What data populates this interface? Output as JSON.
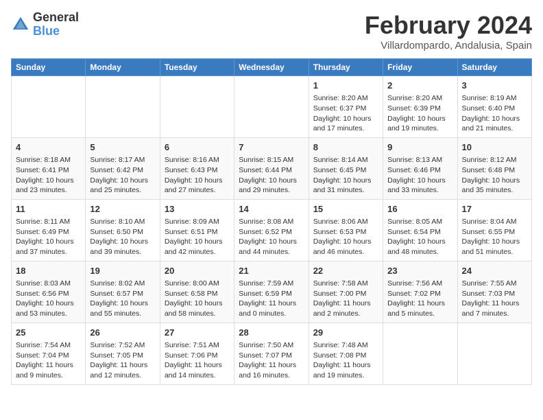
{
  "logo": {
    "line1": "General",
    "line2": "Blue"
  },
  "title": "February 2024",
  "subtitle": "Villardompardo, Andalusia, Spain",
  "headers": [
    "Sunday",
    "Monday",
    "Tuesday",
    "Wednesday",
    "Thursday",
    "Friday",
    "Saturday"
  ],
  "weeks": [
    [
      {
        "day": "",
        "info": ""
      },
      {
        "day": "",
        "info": ""
      },
      {
        "day": "",
        "info": ""
      },
      {
        "day": "",
        "info": ""
      },
      {
        "day": "1",
        "info": "Sunrise: 8:20 AM\nSunset: 6:37 PM\nDaylight: 10 hours\nand 17 minutes."
      },
      {
        "day": "2",
        "info": "Sunrise: 8:20 AM\nSunset: 6:39 PM\nDaylight: 10 hours\nand 19 minutes."
      },
      {
        "day": "3",
        "info": "Sunrise: 8:19 AM\nSunset: 6:40 PM\nDaylight: 10 hours\nand 21 minutes."
      }
    ],
    [
      {
        "day": "4",
        "info": "Sunrise: 8:18 AM\nSunset: 6:41 PM\nDaylight: 10 hours\nand 23 minutes."
      },
      {
        "day": "5",
        "info": "Sunrise: 8:17 AM\nSunset: 6:42 PM\nDaylight: 10 hours\nand 25 minutes."
      },
      {
        "day": "6",
        "info": "Sunrise: 8:16 AM\nSunset: 6:43 PM\nDaylight: 10 hours\nand 27 minutes."
      },
      {
        "day": "7",
        "info": "Sunrise: 8:15 AM\nSunset: 6:44 PM\nDaylight: 10 hours\nand 29 minutes."
      },
      {
        "day": "8",
        "info": "Sunrise: 8:14 AM\nSunset: 6:45 PM\nDaylight: 10 hours\nand 31 minutes."
      },
      {
        "day": "9",
        "info": "Sunrise: 8:13 AM\nSunset: 6:46 PM\nDaylight: 10 hours\nand 33 minutes."
      },
      {
        "day": "10",
        "info": "Sunrise: 8:12 AM\nSunset: 6:48 PM\nDaylight: 10 hours\nand 35 minutes."
      }
    ],
    [
      {
        "day": "11",
        "info": "Sunrise: 8:11 AM\nSunset: 6:49 PM\nDaylight: 10 hours\nand 37 minutes."
      },
      {
        "day": "12",
        "info": "Sunrise: 8:10 AM\nSunset: 6:50 PM\nDaylight: 10 hours\nand 39 minutes."
      },
      {
        "day": "13",
        "info": "Sunrise: 8:09 AM\nSunset: 6:51 PM\nDaylight: 10 hours\nand 42 minutes."
      },
      {
        "day": "14",
        "info": "Sunrise: 8:08 AM\nSunset: 6:52 PM\nDaylight: 10 hours\nand 44 minutes."
      },
      {
        "day": "15",
        "info": "Sunrise: 8:06 AM\nSunset: 6:53 PM\nDaylight: 10 hours\nand 46 minutes."
      },
      {
        "day": "16",
        "info": "Sunrise: 8:05 AM\nSunset: 6:54 PM\nDaylight: 10 hours\nand 48 minutes."
      },
      {
        "day": "17",
        "info": "Sunrise: 8:04 AM\nSunset: 6:55 PM\nDaylight: 10 hours\nand 51 minutes."
      }
    ],
    [
      {
        "day": "18",
        "info": "Sunrise: 8:03 AM\nSunset: 6:56 PM\nDaylight: 10 hours\nand 53 minutes."
      },
      {
        "day": "19",
        "info": "Sunrise: 8:02 AM\nSunset: 6:57 PM\nDaylight: 10 hours\nand 55 minutes."
      },
      {
        "day": "20",
        "info": "Sunrise: 8:00 AM\nSunset: 6:58 PM\nDaylight: 10 hours\nand 58 minutes."
      },
      {
        "day": "21",
        "info": "Sunrise: 7:59 AM\nSunset: 6:59 PM\nDaylight: 11 hours\nand 0 minutes."
      },
      {
        "day": "22",
        "info": "Sunrise: 7:58 AM\nSunset: 7:00 PM\nDaylight: 11 hours\nand 2 minutes."
      },
      {
        "day": "23",
        "info": "Sunrise: 7:56 AM\nSunset: 7:02 PM\nDaylight: 11 hours\nand 5 minutes."
      },
      {
        "day": "24",
        "info": "Sunrise: 7:55 AM\nSunset: 7:03 PM\nDaylight: 11 hours\nand 7 minutes."
      }
    ],
    [
      {
        "day": "25",
        "info": "Sunrise: 7:54 AM\nSunset: 7:04 PM\nDaylight: 11 hours\nand 9 minutes."
      },
      {
        "day": "26",
        "info": "Sunrise: 7:52 AM\nSunset: 7:05 PM\nDaylight: 11 hours\nand 12 minutes."
      },
      {
        "day": "27",
        "info": "Sunrise: 7:51 AM\nSunset: 7:06 PM\nDaylight: 11 hours\nand 14 minutes."
      },
      {
        "day": "28",
        "info": "Sunrise: 7:50 AM\nSunset: 7:07 PM\nDaylight: 11 hours\nand 16 minutes."
      },
      {
        "day": "29",
        "info": "Sunrise: 7:48 AM\nSunset: 7:08 PM\nDaylight: 11 hours\nand 19 minutes."
      },
      {
        "day": "",
        "info": ""
      },
      {
        "day": "",
        "info": ""
      }
    ]
  ]
}
